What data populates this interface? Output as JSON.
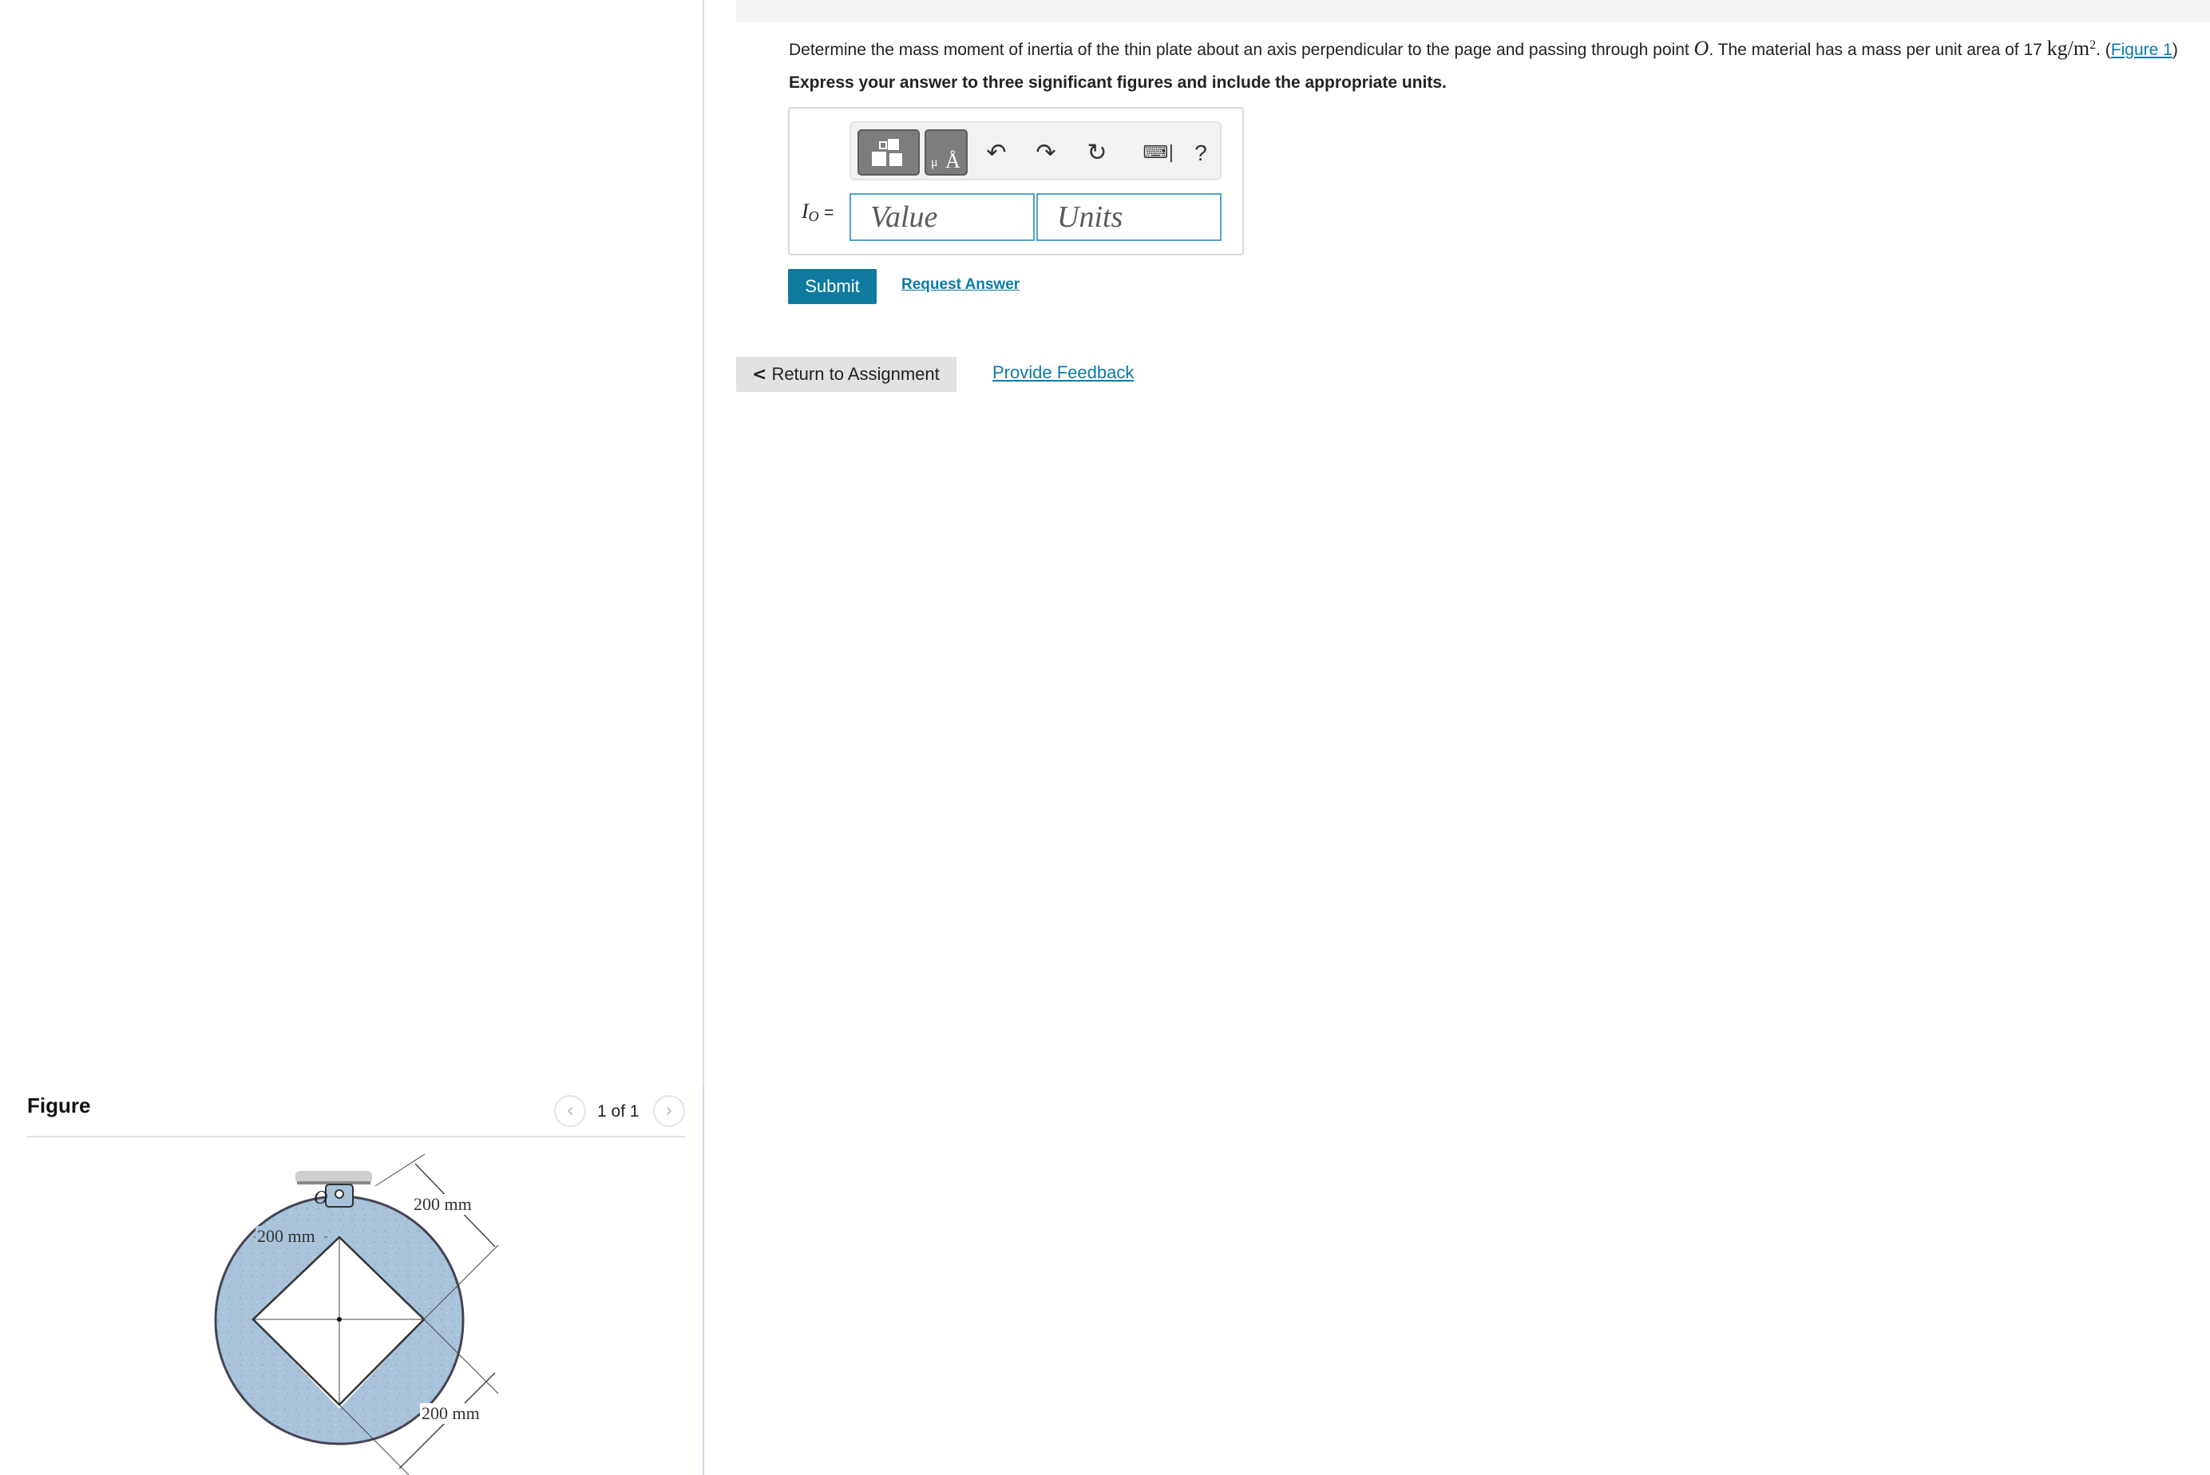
{
  "question": {
    "text_before_point": "Determine the mass moment of inertia of the thin plate about an axis perpendicular to the page and passing through point ",
    "point_symbol": "O",
    "text_after_point": ". The material has a mass per unit area of 17 ",
    "units_num": "kg",
    "units_den": "m",
    "units_exp": "2",
    "text_before_link": ". (",
    "figure_link": "Figure 1",
    "text_after_link": ")"
  },
  "instruction": "Express your answer to three significant figures and include the appropriate units.",
  "answer": {
    "label_symbol": "I",
    "label_subscript": "O",
    "label_equals": "=",
    "value_placeholder": "Value",
    "units_placeholder": "Units",
    "toolbar_icons": [
      "templates-icon",
      "units-symbol-icon",
      "undo-icon",
      "redo-icon",
      "reset-icon",
      "keyboard-icon",
      "help-icon"
    ],
    "help_label": "?"
  },
  "buttons": {
    "submit": "Submit",
    "request_answer": "Request Answer",
    "return_to_assignment": "Return to Assignment",
    "provide_feedback": "Provide Feedback"
  },
  "figure": {
    "title": "Figure",
    "pager": "1 of 1",
    "point_label": "O",
    "dim_left": "200 mm",
    "dim_top_right": "200 mm",
    "dim_bottom_right": "200 mm"
  },
  "colors": {
    "accent": "#0e7a9e",
    "link": "#0a7aa8",
    "input_border": "#4ea3c9",
    "plate_fill": "#a9c4da"
  }
}
